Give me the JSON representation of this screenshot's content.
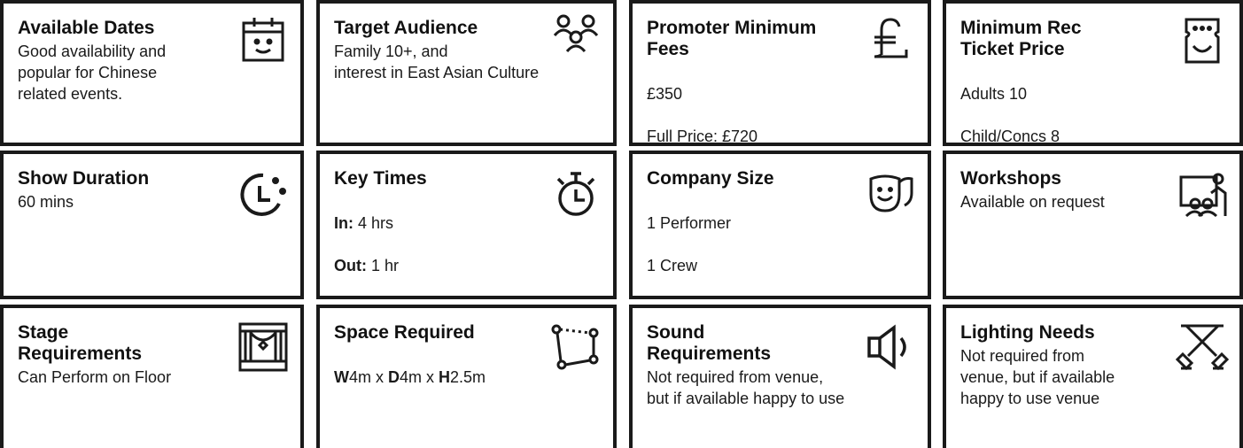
{
  "cards": {
    "available_dates": {
      "title": "Available Dates",
      "body": "Good availability and\npopular for Chinese\nrelated events.",
      "icon": "calendar-smile-icon"
    },
    "target_audience": {
      "title": "Target Audience",
      "body": "Family 10+, and\ninterest in East Asian Culture",
      "icon": "people-group-icon"
    },
    "promoter_fees": {
      "title": "Promoter Minimum\nFees",
      "line1": "£350",
      "line2": "Full Price: £720",
      "icon": "pound-sign-icon"
    },
    "ticket_price": {
      "title": "Minimum Rec\nTicket Price",
      "line1": "Adults 10",
      "line2": "Child/Concs 8",
      "icon": "ticket-smile-icon"
    },
    "show_duration": {
      "title": "Show Duration",
      "body": "60 mins",
      "icon": "clock-icon"
    },
    "key_times": {
      "title": "Key Times",
      "in_label": "In:",
      "in_value": " 4 hrs",
      "out_label": "Out:",
      "out_value": " 1 hr",
      "icon": "stopwatch-icon"
    },
    "company_size": {
      "title": "Company Size",
      "line1": "1 Performer",
      "line2": "1 Crew",
      "icon": "theatre-masks-icon"
    },
    "workshops": {
      "title": "Workshops",
      "body": "Available on request",
      "icon": "workshop-presenter-icon"
    },
    "stage_requirements": {
      "title": "Stage\nRequirements",
      "body": "Can Perform on Floor",
      "icon": "stage-curtains-icon"
    },
    "space_required": {
      "title": "Space Required",
      "w_label": "W",
      "w_value": "4m x ",
      "d_label": "D",
      "d_value": "4m x ",
      "h_label": "H",
      "h_value": "2.5m",
      "icon": "space-dimensions-icon"
    },
    "sound_requirements": {
      "title": "Sound\nRequirements",
      "body": "Not required from venue,\nbut if available happy to use",
      "icon": "speaker-icon"
    },
    "lighting_needs": {
      "title": "Lighting Needs",
      "body": "Not required from\nvenue, but if available\nhappy to use venue",
      "icon": "stage-lights-icon"
    }
  }
}
